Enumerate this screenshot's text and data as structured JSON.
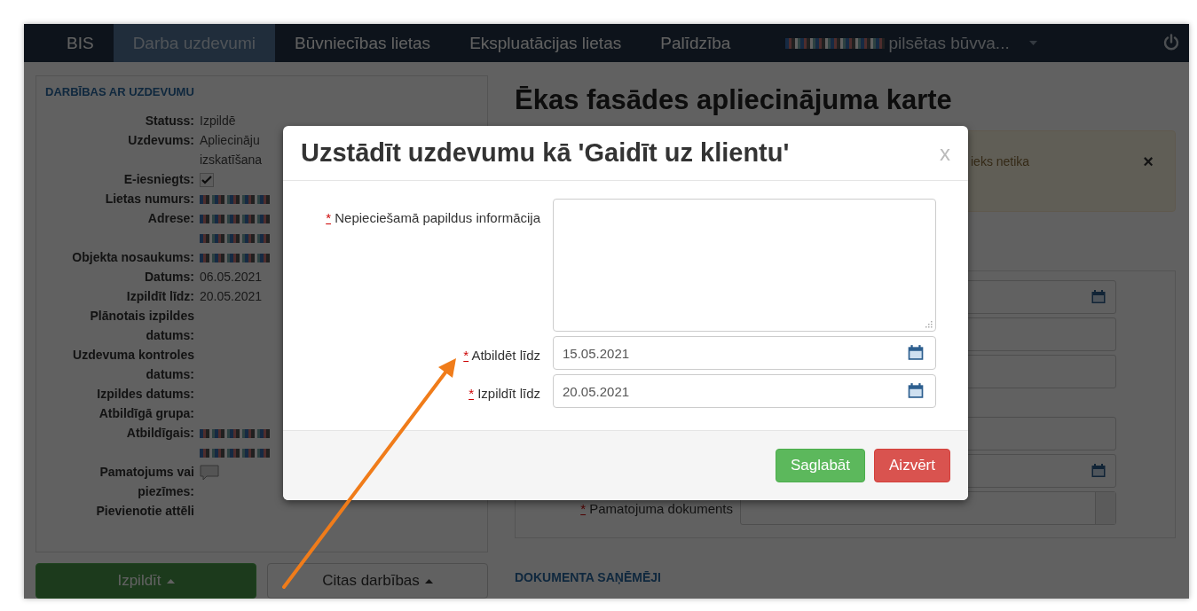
{
  "nav": {
    "items": [
      {
        "label": "BIS",
        "selected": false
      },
      {
        "label": "Darba uzdevumi",
        "selected": true
      },
      {
        "label": "Būvniecības lietas",
        "selected": false
      },
      {
        "label": "Ekspluatācijas lietas",
        "selected": false
      },
      {
        "label": "Palīdzība",
        "selected": false
      }
    ],
    "user": "pilsētas būvva..."
  },
  "task_panel": {
    "heading": "DARBĪBAS AR UZDEVUMU",
    "rows": [
      {
        "label": "Statuss:",
        "kind": "text",
        "lines": [
          "Izpildē"
        ]
      },
      {
        "label": "Uzdevums:",
        "kind": "text",
        "lines": [
          "Apliecināju",
          "izskatīšana"
        ]
      },
      {
        "label": "E-iesniegts:",
        "kind": "checkbox",
        "checked": true
      },
      {
        "label": "Lietas numurs:",
        "kind": "blurred"
      },
      {
        "label": "Adrese:",
        "kind": "blurred_multiline"
      },
      {
        "label": "Objekta nosaukums:",
        "kind": "blurred"
      },
      {
        "label": "Datums:",
        "kind": "text",
        "lines": [
          "06.05.2021"
        ]
      },
      {
        "label": "Izpildīt līdz:",
        "kind": "text",
        "lines": [
          "20.05.2021"
        ]
      },
      {
        "label": "Plānotais izpildes datums:",
        "kind": "empty"
      },
      {
        "label": "Uzdevuma kontroles datums:",
        "kind": "empty"
      },
      {
        "label": "Izpildes datums:",
        "kind": "empty"
      },
      {
        "label": "Atbildīgā grupa:",
        "kind": "empty"
      },
      {
        "label": "Atbildīgais:",
        "kind": "blurred_multiline"
      },
      {
        "label": "Pamatojums vai piezīmes:",
        "kind": "note"
      },
      {
        "label": "Pievienotie attēli",
        "kind": "empty"
      }
    ],
    "buttons": [
      {
        "label": "Izpildīt",
        "kind": "success"
      },
      {
        "label": "Citas darbības",
        "kind": "default"
      }
    ]
  },
  "main": {
    "title": "Ēkas fasādes apliecinājuma karte",
    "alert": {
      "text": "ieks netika",
      "close": "×"
    },
    "form_rows": [
      {
        "kind": "date"
      },
      {
        "kind": "text"
      },
      {
        "kind": "text"
      },
      {
        "kind": "gap"
      },
      {
        "kind": "text"
      },
      {
        "kind": "date"
      },
      {
        "kind": "select",
        "label": "Pamatojuma dokuments",
        "marker": "*"
      }
    ],
    "section_heading": "DOKUMENTA SAŅĒMĒJI"
  },
  "modal": {
    "title": "Uzstādīt uzdevumu kā 'Gaidīt uz klientu'",
    "close": "x",
    "fields": [
      {
        "label": "Nepieciešamā papildus informācija",
        "marker": "*",
        "kind": "textarea"
      },
      {
        "label": "Atbildēt līdz",
        "marker": "*",
        "kind": "date",
        "value": "15.05.2021"
      },
      {
        "label": "Izpildīt līdz",
        "marker": "*",
        "kind": "date",
        "value": "20.05.2021"
      }
    ],
    "buttons": [
      {
        "label": "Saglabāt",
        "kind": "success"
      },
      {
        "label": "Aizvērt",
        "kind": "danger"
      }
    ]
  }
}
